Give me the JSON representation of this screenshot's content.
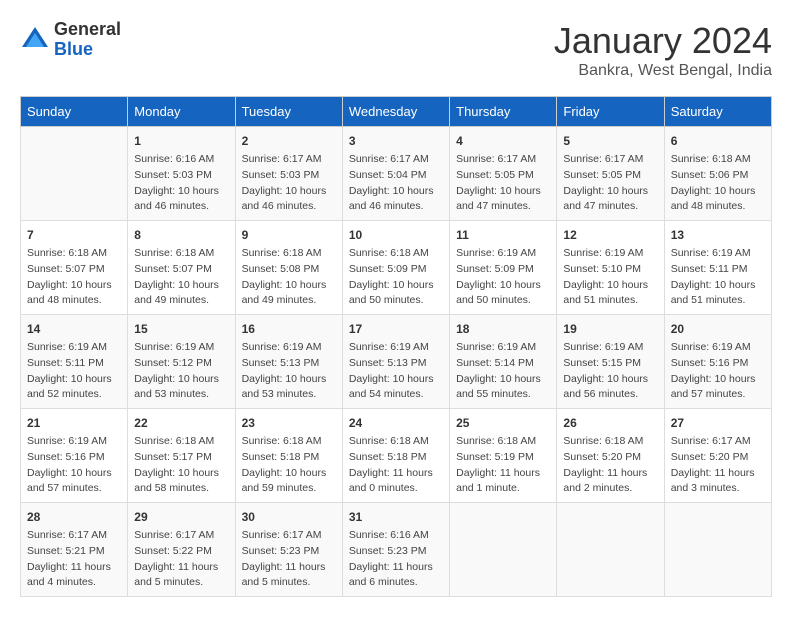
{
  "logo": {
    "general": "General",
    "blue": "Blue"
  },
  "title": "January 2024",
  "subtitle": "Bankra, West Bengal, India",
  "headers": [
    "Sunday",
    "Monday",
    "Tuesday",
    "Wednesday",
    "Thursday",
    "Friday",
    "Saturday"
  ],
  "weeks": [
    [
      {
        "day": "",
        "info": ""
      },
      {
        "day": "1",
        "info": "Sunrise: 6:16 AM\nSunset: 5:03 PM\nDaylight: 10 hours\nand 46 minutes."
      },
      {
        "day": "2",
        "info": "Sunrise: 6:17 AM\nSunset: 5:03 PM\nDaylight: 10 hours\nand 46 minutes."
      },
      {
        "day": "3",
        "info": "Sunrise: 6:17 AM\nSunset: 5:04 PM\nDaylight: 10 hours\nand 46 minutes."
      },
      {
        "day": "4",
        "info": "Sunrise: 6:17 AM\nSunset: 5:05 PM\nDaylight: 10 hours\nand 47 minutes."
      },
      {
        "day": "5",
        "info": "Sunrise: 6:17 AM\nSunset: 5:05 PM\nDaylight: 10 hours\nand 47 minutes."
      },
      {
        "day": "6",
        "info": "Sunrise: 6:18 AM\nSunset: 5:06 PM\nDaylight: 10 hours\nand 48 minutes."
      }
    ],
    [
      {
        "day": "7",
        "info": "Sunrise: 6:18 AM\nSunset: 5:07 PM\nDaylight: 10 hours\nand 48 minutes."
      },
      {
        "day": "8",
        "info": "Sunrise: 6:18 AM\nSunset: 5:07 PM\nDaylight: 10 hours\nand 49 minutes."
      },
      {
        "day": "9",
        "info": "Sunrise: 6:18 AM\nSunset: 5:08 PM\nDaylight: 10 hours\nand 49 minutes."
      },
      {
        "day": "10",
        "info": "Sunrise: 6:18 AM\nSunset: 5:09 PM\nDaylight: 10 hours\nand 50 minutes."
      },
      {
        "day": "11",
        "info": "Sunrise: 6:19 AM\nSunset: 5:09 PM\nDaylight: 10 hours\nand 50 minutes."
      },
      {
        "day": "12",
        "info": "Sunrise: 6:19 AM\nSunset: 5:10 PM\nDaylight: 10 hours\nand 51 minutes."
      },
      {
        "day": "13",
        "info": "Sunrise: 6:19 AM\nSunset: 5:11 PM\nDaylight: 10 hours\nand 51 minutes."
      }
    ],
    [
      {
        "day": "14",
        "info": "Sunrise: 6:19 AM\nSunset: 5:11 PM\nDaylight: 10 hours\nand 52 minutes."
      },
      {
        "day": "15",
        "info": "Sunrise: 6:19 AM\nSunset: 5:12 PM\nDaylight: 10 hours\nand 53 minutes."
      },
      {
        "day": "16",
        "info": "Sunrise: 6:19 AM\nSunset: 5:13 PM\nDaylight: 10 hours\nand 53 minutes."
      },
      {
        "day": "17",
        "info": "Sunrise: 6:19 AM\nSunset: 5:13 PM\nDaylight: 10 hours\nand 54 minutes."
      },
      {
        "day": "18",
        "info": "Sunrise: 6:19 AM\nSunset: 5:14 PM\nDaylight: 10 hours\nand 55 minutes."
      },
      {
        "day": "19",
        "info": "Sunrise: 6:19 AM\nSunset: 5:15 PM\nDaylight: 10 hours\nand 56 minutes."
      },
      {
        "day": "20",
        "info": "Sunrise: 6:19 AM\nSunset: 5:16 PM\nDaylight: 10 hours\nand 57 minutes."
      }
    ],
    [
      {
        "day": "21",
        "info": "Sunrise: 6:19 AM\nSunset: 5:16 PM\nDaylight: 10 hours\nand 57 minutes."
      },
      {
        "day": "22",
        "info": "Sunrise: 6:18 AM\nSunset: 5:17 PM\nDaylight: 10 hours\nand 58 minutes."
      },
      {
        "day": "23",
        "info": "Sunrise: 6:18 AM\nSunset: 5:18 PM\nDaylight: 10 hours\nand 59 minutes."
      },
      {
        "day": "24",
        "info": "Sunrise: 6:18 AM\nSunset: 5:18 PM\nDaylight: 11 hours\nand 0 minutes."
      },
      {
        "day": "25",
        "info": "Sunrise: 6:18 AM\nSunset: 5:19 PM\nDaylight: 11 hours\nand 1 minute."
      },
      {
        "day": "26",
        "info": "Sunrise: 6:18 AM\nSunset: 5:20 PM\nDaylight: 11 hours\nand 2 minutes."
      },
      {
        "day": "27",
        "info": "Sunrise: 6:17 AM\nSunset: 5:20 PM\nDaylight: 11 hours\nand 3 minutes."
      }
    ],
    [
      {
        "day": "28",
        "info": "Sunrise: 6:17 AM\nSunset: 5:21 PM\nDaylight: 11 hours\nand 4 minutes."
      },
      {
        "day": "29",
        "info": "Sunrise: 6:17 AM\nSunset: 5:22 PM\nDaylight: 11 hours\nand 5 minutes."
      },
      {
        "day": "30",
        "info": "Sunrise: 6:17 AM\nSunset: 5:23 PM\nDaylight: 11 hours\nand 5 minutes."
      },
      {
        "day": "31",
        "info": "Sunrise: 6:16 AM\nSunset: 5:23 PM\nDaylight: 11 hours\nand 6 minutes."
      },
      {
        "day": "",
        "info": ""
      },
      {
        "day": "",
        "info": ""
      },
      {
        "day": "",
        "info": ""
      }
    ]
  ]
}
